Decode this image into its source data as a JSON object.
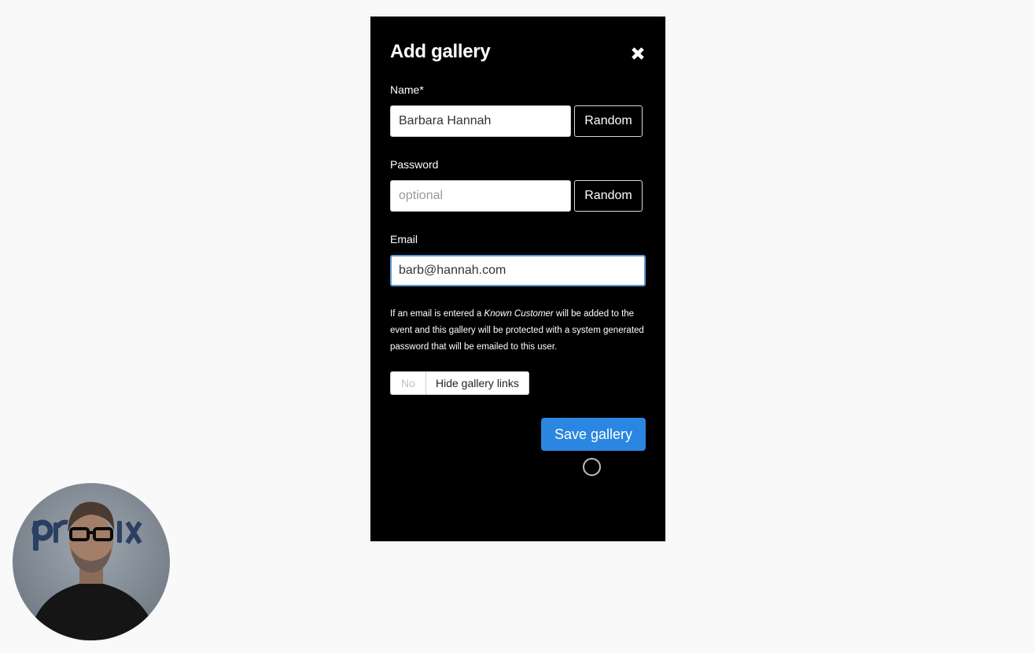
{
  "modal": {
    "title": "Add gallery",
    "close_icon": "close-icon"
  },
  "form": {
    "name": {
      "label": "Name*",
      "value": "Barbara Hannah",
      "random_label": "Random"
    },
    "password": {
      "label": "Password",
      "value": "",
      "placeholder": "optional",
      "random_label": "Random"
    },
    "email": {
      "label": "Email",
      "value": "barb@hannah.com"
    },
    "help": {
      "before": "If an email is entered a ",
      "emphasis": "Known Customer",
      "after": " will be added to the event and this gallery will be protected with a system generated password that will be emailed to this user."
    },
    "hide_links": {
      "state": "No",
      "label": "Hide gallery links"
    },
    "save_label": "Save gallery"
  },
  "webcam": {
    "logo_text": "pr   ix"
  },
  "colors": {
    "modal_bg": "#000000",
    "page_bg": "#f8f9f8",
    "primary": "#2a86e0"
  }
}
